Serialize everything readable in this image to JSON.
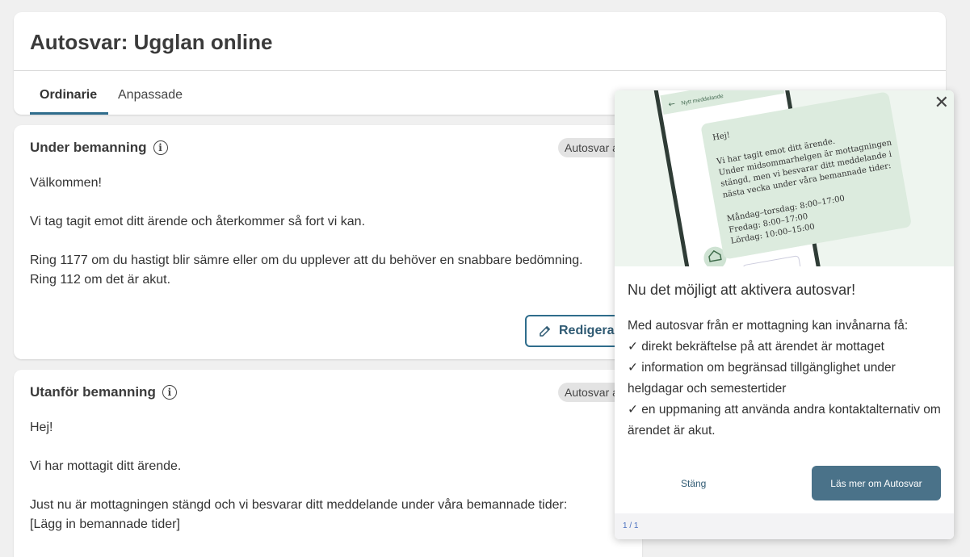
{
  "header": {
    "title": "Autosvar: Ugglan online",
    "tabs": [
      {
        "label": "Ordinarie",
        "active": true
      },
      {
        "label": "Anpassade",
        "active": false
      }
    ]
  },
  "cards": [
    {
      "title": "Under bemanning",
      "badge": "Autosvar a",
      "lines": [
        "Välkommen!",
        "",
        "Vi tag tagit emot ditt ärende och återkommer så fort vi kan.",
        "",
        "Ring 1177 om du hastigt blir sämre eller om du upplever att du behöver en snabbare bedömning.",
        "Ring 112 om det är akut."
      ],
      "edit_label": "Redigera"
    },
    {
      "title": "Utanför bemanning",
      "badge": "Autosvar a",
      "lines": [
        "Hej!",
        "",
        "Vi har mottagit ditt ärende.",
        "",
        "Just nu är mottagningen stängd och vi besvarar ditt meddelande under våra bemannade tider:",
        "[Lägg in bemannade tider]"
      ]
    }
  ],
  "popover": {
    "phone": {
      "header": "Nytt meddelande",
      "message_lines": [
        "Hej!",
        "",
        "Vi har tagit emot ditt ärende.",
        "Under midsommarhelgen är mottagningen",
        "stängd, men vi besvarar ditt meddelande i",
        "nästa vecka under våra bemannade tider:",
        "",
        "Måndag–torsdag: 8:00–17:00",
        "Fredag: 8:00–17:00",
        "Lördag: 10:00–15:00"
      ]
    },
    "title": "Nu det möjligt att aktivera autosvar!",
    "body_lines": [
      "Med autosvar från er mottagning kan invånarna få:",
      "✓ direkt bekräftelse på att ärendet är mottaget",
      "✓ information om begränsad tillgänglighet under helgdagar och semestertider",
      "✓ en uppmaning att använda andra kontaktalternativ om ärendet är akut."
    ],
    "close_label": "Stäng",
    "more_label": "Läs mer om Autosvar",
    "counter": "1 / 1"
  },
  "colors": {
    "accent": "#2f6d8c",
    "button_primary": "#4a7289",
    "illustration_bg": "#eef5ef",
    "bubble": "#dcebde"
  }
}
